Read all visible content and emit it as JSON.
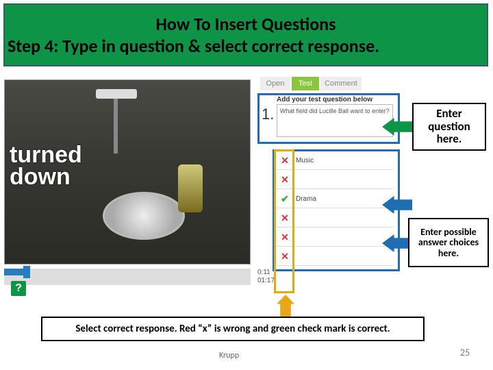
{
  "header": {
    "line1": "How To Insert Questions",
    "line2": "Step 4: Type in question & select correct response."
  },
  "video": {
    "overlay_line1": "turned",
    "overlay_line2": "down",
    "time_current": "0:11",
    "time_total": "01:17",
    "help_icon": "?"
  },
  "panel": {
    "tabs": {
      "open": "Open",
      "test": "Test",
      "comment": "Comment"
    },
    "prompt": "Add your test question below",
    "number": "1.",
    "question_text": "What field did Lucille Ball want to enter?",
    "answers": [
      "Music",
      "",
      "Drama",
      "",
      "",
      ""
    ],
    "marks": [
      "x",
      "x",
      "check",
      "x",
      "x",
      "x"
    ]
  },
  "callouts": {
    "c1": "Enter question here.",
    "c2": "Enter possible answer choices here.",
    "c3": "Select correct response. Red “x” is wrong and green check mark is correct."
  },
  "footer": {
    "author": "Krupp",
    "page": "25"
  }
}
